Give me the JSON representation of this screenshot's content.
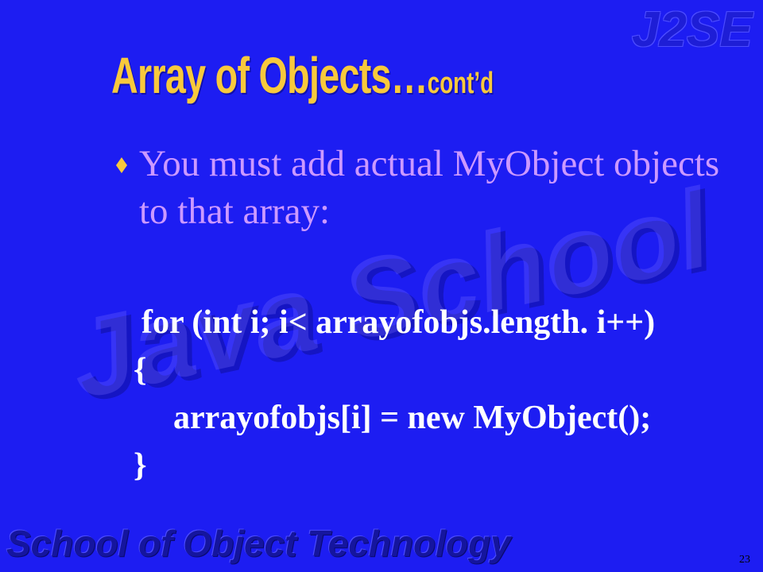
{
  "slide": {
    "title_main": "Array of Objects…",
    "title_suffix": "cont’d",
    "bullet": {
      "icon": "diamond-bullet-icon",
      "lines": [
        "You must add actual MyObject objects",
        "to that array:"
      ]
    },
    "code": [
      "for (int i; i< arrayofobjs.length. i++)",
      "{",
      "arrayofobjs[i] = new MyObject();",
      "}"
    ],
    "page_number": "23"
  },
  "branding": {
    "top_logo": "J2SE",
    "watermark": "Java School",
    "footer": "School of Object Technology"
  },
  "colors": {
    "background": "#1d1df2",
    "title": "#f8c93c",
    "bullet_text": "#cc99ff",
    "code_text": "#ffffff"
  }
}
